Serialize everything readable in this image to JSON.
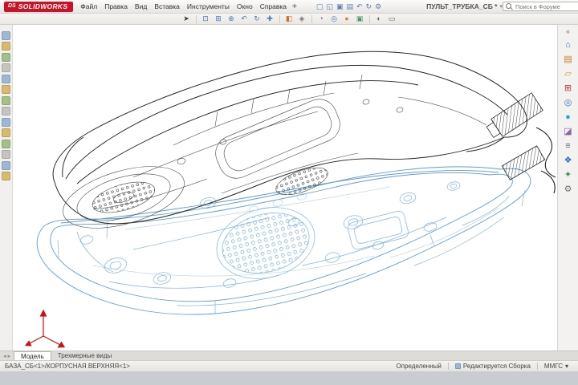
{
  "colors": {
    "brand_red": "#cf1126",
    "wireframe_black": "#222222",
    "wireframe_blue": "#5f9bd8",
    "triad_red": "#cc1111",
    "viewport_bg": "#ffffff"
  },
  "menu_bar": {
    "logo": {
      "ds": "DS",
      "text": "SOLIDWORKS"
    },
    "menus": [
      "Файл",
      "Правка",
      "Вид",
      "Вставка",
      "Инструменты",
      "Окно",
      "Справка"
    ],
    "pin_glyph": "✚",
    "quick_icons": [
      {
        "name": "new-document-icon",
        "glyph": "▢"
      },
      {
        "name": "open-document-icon",
        "glyph": "◱"
      },
      {
        "name": "save-icon",
        "glyph": "▣"
      },
      {
        "name": "print-icon",
        "glyph": "▤"
      },
      {
        "name": "undo-icon",
        "glyph": "↶"
      },
      {
        "name": "rebuild-icon",
        "glyph": "↻"
      },
      {
        "name": "options-icon",
        "glyph": "⚙"
      }
    ],
    "document_title": "ПУЛЬТ_ТРУБКА_СБ *",
    "title_chevron": "▾",
    "search": {
      "placeholder": "Поиск в Форуме",
      "chevron": "▾",
      "help": "?"
    },
    "window_controls": [
      {
        "name": "minimize-button",
        "glyph": "–"
      },
      {
        "name": "maximize-button",
        "glyph": "▢"
      },
      {
        "name": "close-button",
        "glyph": "×"
      }
    ]
  },
  "view_toolbar": {
    "icons": [
      {
        "name": "select-tool-icon",
        "glyph": "➤",
        "color": "#3a3a3a"
      },
      {
        "name": "zoom-fit-icon",
        "glyph": "⊡",
        "color": "#4a7ab5"
      },
      {
        "name": "zoom-area-icon",
        "glyph": "⊞",
        "color": "#4a7ab5"
      },
      {
        "name": "zoom-in-out-icon",
        "glyph": "⊕",
        "color": "#4a7ab5"
      },
      {
        "name": "previous-view-icon",
        "glyph": "↶",
        "color": "#4a7ab5"
      },
      {
        "name": "rotate-view-icon",
        "glyph": "↻",
        "color": "#4a7ab5"
      },
      {
        "name": "pan-icon",
        "glyph": "✚",
        "color": "#4a7ab5"
      },
      {
        "name": "section-view-icon",
        "glyph": "◧",
        "color": "#d07030"
      },
      {
        "name": "view-orientation-icon",
        "glyph": "◈",
        "color": "#777777"
      },
      {
        "name": "display-style-icon",
        "glyph": "◔",
        "color": "#666666"
      },
      {
        "name": "hide-show-items-icon",
        "glyph": "◎",
        "color": "#4a7ab5"
      },
      {
        "name": "edit-appearance-icon",
        "glyph": "●",
        "color": "#e0862e"
      },
      {
        "name": "apply-scene-icon",
        "glyph": "▣",
        "color": "#4a9a6a"
      },
      {
        "name": "view-settings-icon",
        "glyph": "◐",
        "color": "#666666"
      },
      {
        "name": "camera-icon",
        "glyph": "▭",
        "color": "#666666"
      }
    ]
  },
  "left_toolbar": {
    "icons": [
      "assembly-icon",
      "insert-components-icon",
      "mate-icon",
      "component-pattern-icon",
      "smart-fasteners-icon",
      "move-component-icon",
      "show-hidden-icon",
      "assembly-features-icon",
      "reference-geometry-icon",
      "bill-of-materials-icon",
      "exploded-view-icon",
      "instant-3d-icon",
      "sketch-icon",
      "evaluate-icon"
    ]
  },
  "task_pane": {
    "collapse_glyph": "«",
    "icons": [
      {
        "name": "home-icon",
        "glyph": "⌂",
        "color": "#3d76b8"
      },
      {
        "name": "design-library-icon",
        "glyph": "▤",
        "color": "#c07a2c"
      },
      {
        "name": "file-explorer-icon",
        "glyph": "▱",
        "color": "#d0a040"
      },
      {
        "name": "toolbox-icon",
        "glyph": "⊞",
        "color": "#b04038"
      },
      {
        "name": "view-palette-icon",
        "glyph": "◎",
        "color": "#3d76b8"
      },
      {
        "name": "appearances-icon",
        "glyph": "●",
        "color": "#38a0d8"
      },
      {
        "name": "decals-icon",
        "glyph": "◪",
        "color": "#8a62b0"
      },
      {
        "name": "custom-properties-icon",
        "glyph": "≡",
        "color": "#666666"
      },
      {
        "name": "forum-icon",
        "glyph": "❖",
        "color": "#2e6db4"
      },
      {
        "name": "solidworks-resources-icon",
        "glyph": "✦",
        "color": "#4a8a4a"
      },
      {
        "name": "pane-settings-icon",
        "glyph": "⚙",
        "color": "#777777"
      }
    ]
  },
  "bottom_tabs": {
    "scroll_left": "◂",
    "scroll_right": "▸",
    "tabs": [
      {
        "label": "Модель",
        "active": true
      },
      {
        "label": "Трехмерные виды",
        "active": false
      }
    ]
  },
  "status_bar": {
    "selection": "БАЗА_СБ<1>/КОРПУСНАЯ ВЕРХНЯЯ<1>",
    "state": "Определенный",
    "mode": "Редактируется Сборка",
    "units": "ММГС",
    "units_chevron": "▾"
  }
}
